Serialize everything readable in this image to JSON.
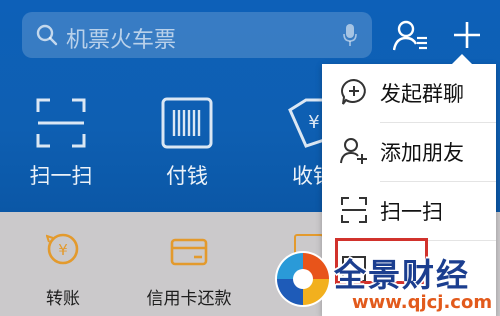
{
  "search": {
    "placeholder": "机票火车票"
  },
  "top_functions": [
    {
      "label": "扫一扫",
      "icon": "scan-icon"
    },
    {
      "label": "付钱",
      "icon": "barcode-icon"
    },
    {
      "label": "收钱",
      "icon": "receive-money-icon"
    }
  ],
  "services": [
    {
      "label": "转账",
      "icon": "transfer-icon"
    },
    {
      "label": "信用卡还款",
      "icon": "credit-card-icon"
    }
  ],
  "popup_menu": {
    "items": [
      {
        "label": "发起群聊",
        "icon": "chat-bubble-plus-icon"
      },
      {
        "label": "添加朋友",
        "icon": "add-friend-icon"
      },
      {
        "label": "扫一扫",
        "icon": "scan-icon"
      }
    ]
  },
  "watermark": {
    "title": "全景财经",
    "url": "www.qjcj.com"
  },
  "colors": {
    "primary_blue": "#0e5fb2",
    "service_orange": "#e39a2d",
    "highlight_red": "#d1322c",
    "popup_bg": "#ffffff"
  }
}
